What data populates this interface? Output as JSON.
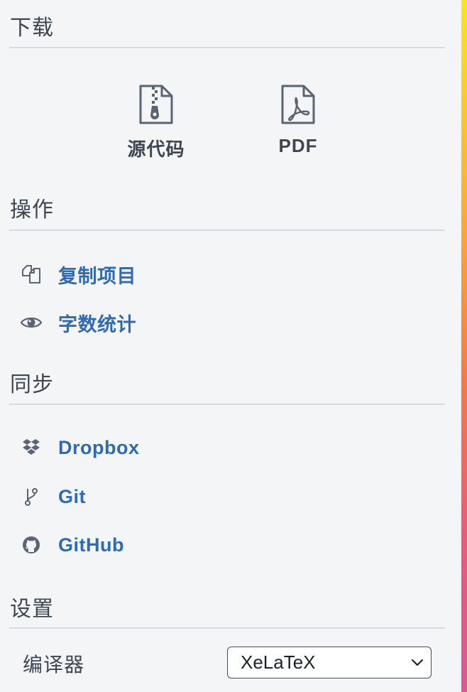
{
  "sections": {
    "download": {
      "title": "下载",
      "items": [
        {
          "label": "源代码",
          "icon": "zip-file-icon"
        },
        {
          "label": "PDF",
          "icon": "pdf-file-icon"
        }
      ]
    },
    "actions": {
      "title": "操作",
      "items": [
        {
          "label": "复制项目",
          "icon": "copy-icon"
        },
        {
          "label": "字数统计",
          "icon": "eye-icon"
        }
      ]
    },
    "sync": {
      "title": "同步",
      "items": [
        {
          "label": "Dropbox",
          "icon": "dropbox-icon"
        },
        {
          "label": "Git",
          "icon": "git-branch-icon"
        },
        {
          "label": "GitHub",
          "icon": "github-icon"
        }
      ]
    },
    "settings": {
      "title": "设置",
      "compiler": {
        "label": "编译器",
        "value": "XeLaTeX"
      }
    }
  },
  "colors": {
    "link": "#2f6ab5",
    "text": "#3e4651",
    "divider": "#d7dae0",
    "background": "#f4f5f6"
  }
}
